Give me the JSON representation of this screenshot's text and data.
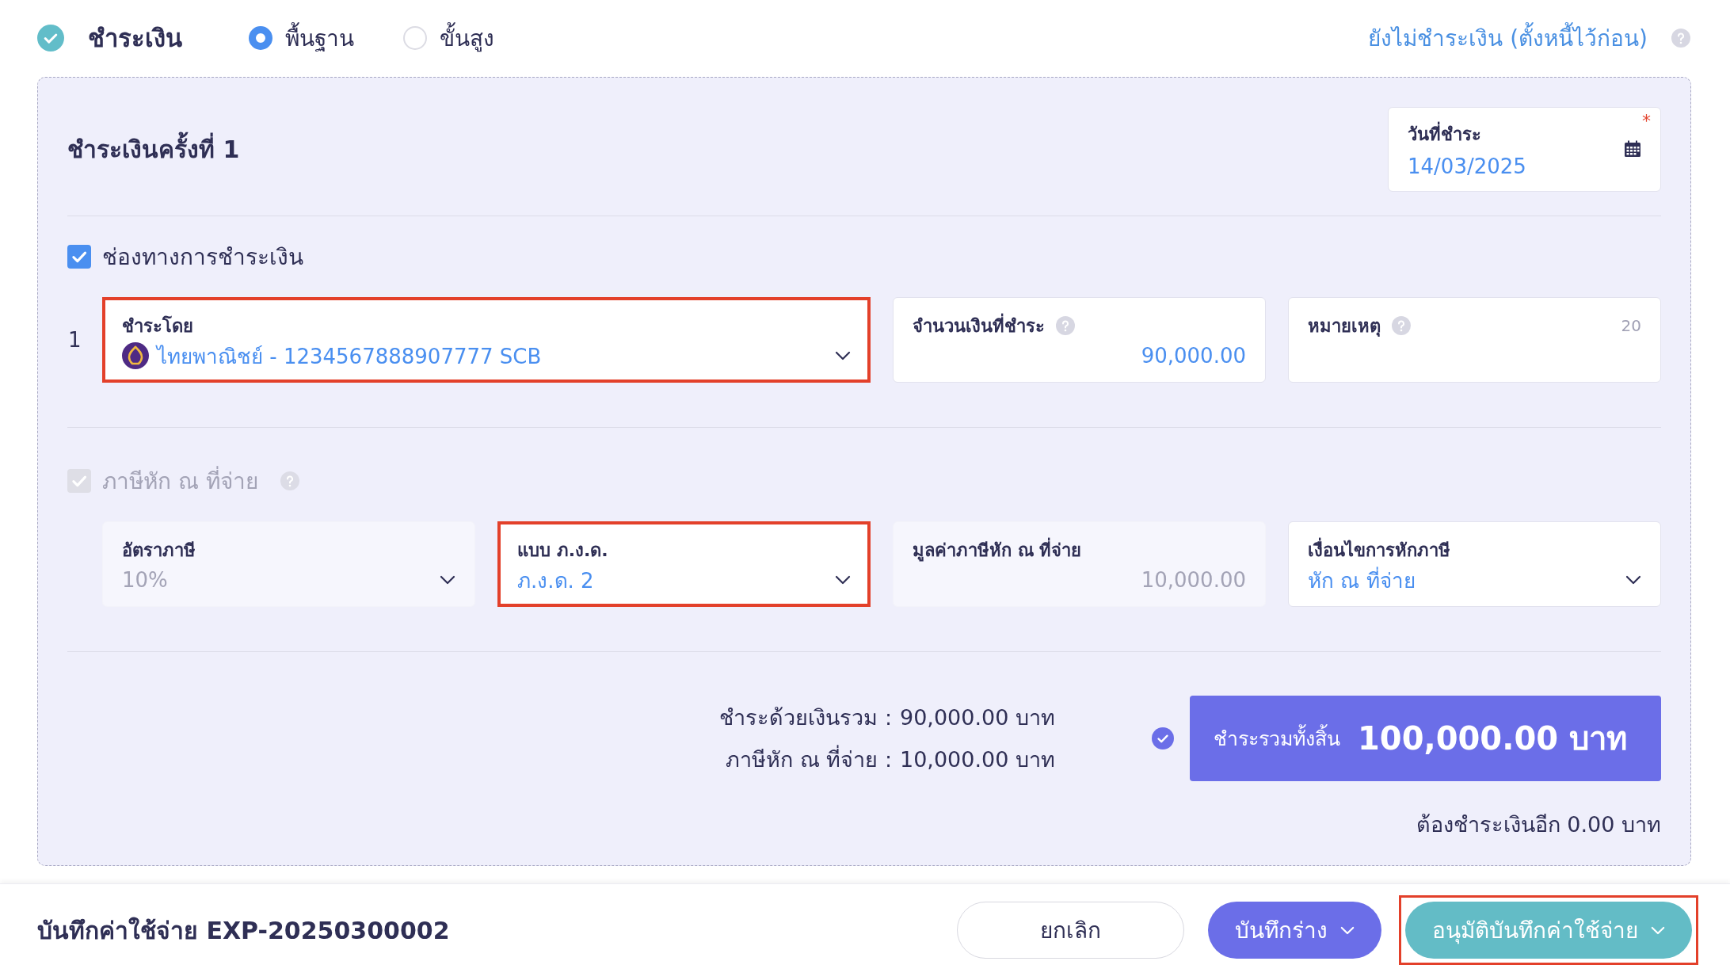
{
  "header": {
    "title": "ชำระเงิน",
    "done": true,
    "modes": [
      {
        "label": "พื้นฐาน",
        "selected": true
      },
      {
        "label": "ขั้นสูง",
        "selected": false
      }
    ],
    "defer_link": "ยังไม่ชำระเงิน (ตั้งหนี้ไว้ก่อน)",
    "defer_help": true
  },
  "payment": {
    "title": "ชำระเงินครั้งที่ 1",
    "date_field": {
      "label": "วันที่ชำระ",
      "value": "14/03/2025",
      "required_mark": "*"
    },
    "channel": {
      "label": "ช่องทางการชำระเงิน",
      "checked": true,
      "disabled": false
    },
    "rows": [
      {
        "index": "1",
        "fields": [
          {
            "kind": "bank_select",
            "label": "ชำระโดย",
            "value": "ไทยพาณิชย์ - 1234567888907777 SCB",
            "help": false,
            "disabled": false,
            "highlighted": true
          },
          {
            "kind": "amount",
            "label": "จำนวนเงินที่ชำระ",
            "value": "90,000.00",
            "help": true,
            "disabled": false,
            "highlighted": false
          },
          {
            "kind": "text",
            "label": "หมายเหตุ",
            "counter": "20",
            "help": true,
            "disabled": false,
            "highlighted": false
          }
        ]
      }
    ],
    "withholding": {
      "label": "ภาษีหัก ณ ที่จ่าย",
      "checked": true,
      "disabled": true,
      "help": true
    },
    "tax_fields": [
      {
        "kind": "select",
        "label": "อัตราภาษี",
        "value": "10%",
        "help": false,
        "disabled": true,
        "highlighted": false
      },
      {
        "kind": "select",
        "label": "แบบ ภ.ง.ด.",
        "value": "ภ.ง.ด. 2",
        "help": false,
        "disabled": false,
        "highlighted": true
      },
      {
        "kind": "amount",
        "label": "มูลค่าภาษีหัก ณ ที่จ่าย",
        "value": "10,000.00",
        "help": false,
        "disabled": true,
        "highlighted": false
      },
      {
        "kind": "select",
        "label": "เงื่อนไขการหักภาษี",
        "value": "หัก ณ ที่จ่าย",
        "help": false,
        "disabled": false,
        "highlighted": false
      }
    ],
    "summary": {
      "lines": [
        {
          "label": "ชำระด้วยเงินรวม :",
          "value": "90,000.00 บาท"
        },
        {
          "label": "ภาษีหัก ณ ที่จ่าย :",
          "value": "10,000.00 บาท"
        }
      ],
      "verified": true,
      "total_label": "ชำระรวมทั้งสิ้น",
      "total_value": "100,000.00 บาท",
      "remaining": "ต้องชำระเงินอีก 0.00 บาท"
    }
  },
  "footer": {
    "title": "บันทึกค่าใช้จ่าย EXP-20250300002",
    "buttons": [
      {
        "kind": "outline",
        "label": "ยกเลิก",
        "dropdown": false,
        "highlighted": false
      },
      {
        "kind": "primary",
        "label": "บันทึกร่าง",
        "dropdown": true,
        "highlighted": false
      },
      {
        "kind": "teal",
        "label": "อนุมัติบันทึกค่าใช้จ่าย",
        "dropdown": true,
        "highlighted": true
      }
    ]
  }
}
